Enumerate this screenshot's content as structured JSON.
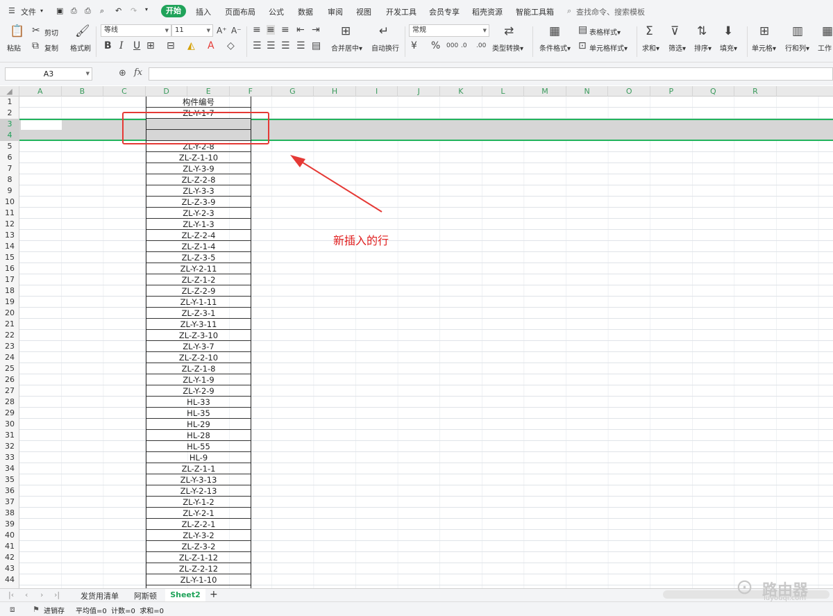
{
  "menubar": {
    "file": "文件",
    "tabs": [
      "开始",
      "插入",
      "页面布局",
      "公式",
      "数据",
      "审阅",
      "视图",
      "开发工具",
      "会员专享",
      "稻壳资源",
      "智能工具箱"
    ],
    "search": "查找命令、搜索模板"
  },
  "ribbon": {
    "paste": "粘贴",
    "cut": "剪切",
    "copy": "复制",
    "format_painter": "格式刷",
    "font_name": "等线",
    "font_size": "11",
    "bold": "B",
    "italic": "I",
    "underline": "U",
    "merge_center": "合并居中",
    "auto_wrap": "自动换行",
    "number_format": "常规",
    "type_convert": "类型转换",
    "conditional_format": "条件格式",
    "table_style": "表格样式",
    "cell_style": "单元格样式",
    "sum": "求和",
    "filter": "筛选",
    "sort": "排序",
    "fill": "填充",
    "cell": "单元格",
    "row_col": "行和列",
    "worksheet": "工作"
  },
  "formula": {
    "namebox": "A3",
    "fx": "fx",
    "value": ""
  },
  "columns": [
    "A",
    "B",
    "C",
    "D",
    "E",
    "F",
    "G",
    "H",
    "I",
    "J",
    "K",
    "L",
    "M",
    "N",
    "O",
    "P",
    "Q",
    "R"
  ],
  "rows": [
    "1",
    "2",
    "3",
    "4",
    "5",
    "6",
    "7",
    "8",
    "9",
    "10",
    "11",
    "12",
    "13",
    "14",
    "15",
    "16",
    "17",
    "18",
    "19",
    "20",
    "21",
    "22",
    "23",
    "24",
    "25",
    "26",
    "27",
    "28",
    "29",
    "30",
    "31",
    "32",
    "33",
    "34",
    "35",
    "36",
    "37",
    "38",
    "39",
    "40",
    "41",
    "42",
    "43",
    "44"
  ],
  "dcells": [
    "构件编号",
    "ZL-Y-1-7",
    "",
    "",
    "ZL-Y-2-8",
    "ZL-Z-1-10",
    "ZL-Y-3-9",
    "ZL-Z-2-8",
    "ZL-Y-3-3",
    "ZL-Z-3-9",
    "ZL-Y-2-3",
    "ZL-Y-1-3",
    "ZL-Z-2-4",
    "ZL-Z-1-4",
    "ZL-Z-3-5",
    "ZL-Y-2-11",
    "ZL-Z-1-2",
    "ZL-Z-2-9",
    "ZL-Y-1-11",
    "ZL-Z-3-1",
    "ZL-Y-3-11",
    "ZL-Z-3-10",
    "ZL-Y-3-7",
    "ZL-Z-2-10",
    "ZL-Z-1-8",
    "ZL-Y-1-9",
    "ZL-Y-2-9",
    "HL-33",
    "HL-35",
    "HL-29",
    "HL-28",
    "HL-55",
    "HL-9",
    "ZL-Z-1-1",
    "ZL-Y-3-13",
    "ZL-Y-2-13",
    "ZL-Y-1-2",
    "ZL-Y-2-1",
    "ZL-Z-2-1",
    "ZL-Y-3-2",
    "ZL-Z-3-2",
    "ZL-Z-1-12",
    "ZL-Z-2-12",
    "ZL-Y-1-10"
  ],
  "annotation": "新插入的行",
  "sheets": [
    "发货用清单",
    "阿斯顿",
    "Sheet2"
  ],
  "status": {
    "mode": "进销存",
    "stats": "平均值=0  计数=0  求和=0"
  },
  "watermark": "路由器 luyouqi.com",
  "colors": {
    "accent": "#20a35a",
    "annotation": "#e02020",
    "selection": "#22b45c"
  }
}
